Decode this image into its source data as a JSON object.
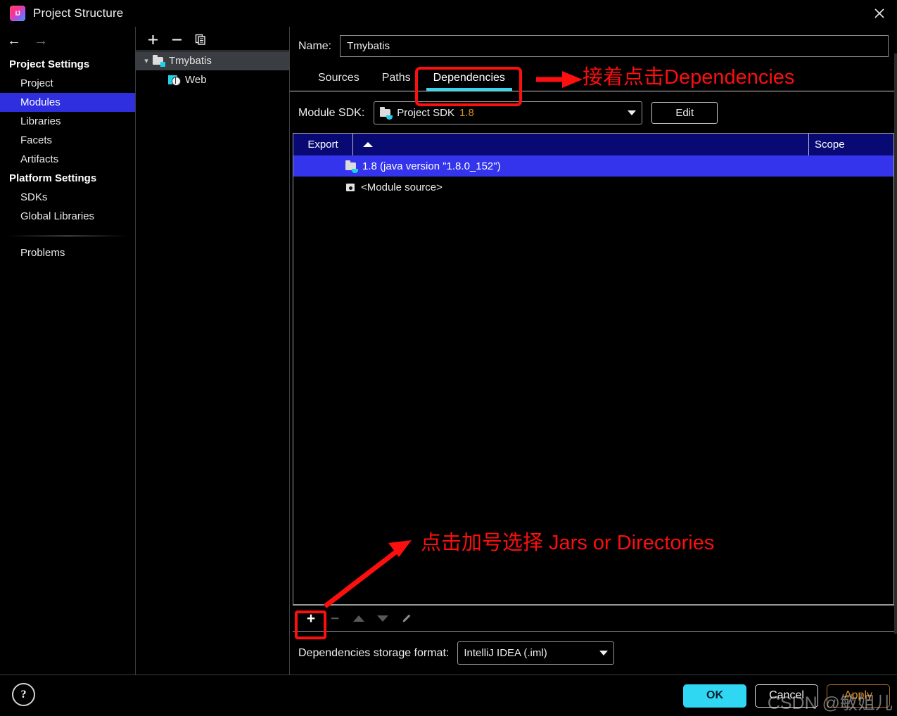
{
  "window": {
    "title": "Project Structure",
    "app_icon": "intellij-idea-logo",
    "close_icon": "close-icon"
  },
  "left_nav": {
    "back_icon": "arrow-left-icon",
    "forward_icon": "arrow-right-icon",
    "groups": [
      {
        "label": "Project Settings",
        "items": [
          {
            "label": "Project",
            "selected": false
          },
          {
            "label": "Modules",
            "selected": true
          },
          {
            "label": "Libraries",
            "selected": false
          },
          {
            "label": "Facets",
            "selected": false
          },
          {
            "label": "Artifacts",
            "selected": false
          }
        ]
      },
      {
        "label": "Platform Settings",
        "items": [
          {
            "label": "SDKs",
            "selected": false
          },
          {
            "label": "Global Libraries",
            "selected": false
          }
        ]
      }
    ],
    "problems_label": "Problems",
    "help_glyph": "?"
  },
  "tree_panel": {
    "toolbar": {
      "add_label": "+",
      "remove_label": "−",
      "copy_icon": "copy-icon"
    },
    "nodes": [
      {
        "label": "Tmybatis",
        "icon": "module-icon",
        "selected": true,
        "expanded": true,
        "depth": 0
      },
      {
        "label": "Web",
        "icon": "web-facet-icon",
        "selected": false,
        "depth": 1
      }
    ]
  },
  "content": {
    "name_label": "Name:",
    "name_value": "Tmybatis",
    "name_placeholder": "",
    "tabs": [
      {
        "label": "Sources",
        "active": false
      },
      {
        "label": "Paths",
        "active": false
      },
      {
        "label": "Dependencies",
        "active": true
      }
    ],
    "module_sdk_label": "Module SDK:",
    "module_sdk_value": "Project SDK",
    "module_sdk_version": "1.8",
    "edit_button": "Edit",
    "table": {
      "columns": [
        "Export",
        "",
        "Scope"
      ],
      "sort_indicator": "ascending",
      "rows": [
        {
          "export": "",
          "name": "1.8 (java version \"1.8.0_152\")",
          "icon": "jdk-icon",
          "scope": "",
          "selected": true
        },
        {
          "export": "",
          "name": "<Module source>",
          "icon": "module-source-icon",
          "scope": "",
          "selected": false
        }
      ]
    },
    "table_toolbar": {
      "add_icon": "plus-icon",
      "remove_icon": "minus-icon",
      "move_up_icon": "arrow-up-icon",
      "move_down_icon": "arrow-down-icon",
      "edit_icon": "pencil-icon"
    },
    "storage_label": "Dependencies storage format:",
    "storage_value": "IntelliJ IDEA (.iml)"
  },
  "footer": {
    "ok": "OK",
    "cancel": "Cancel",
    "apply": "Apply"
  },
  "annotations": {
    "top_note": "接着点击Dependencies",
    "bottom_note": "点击加号选择 Jars or Directories",
    "color": "#fb0f0f"
  },
  "watermark": "CSDN @敏姐儿"
}
